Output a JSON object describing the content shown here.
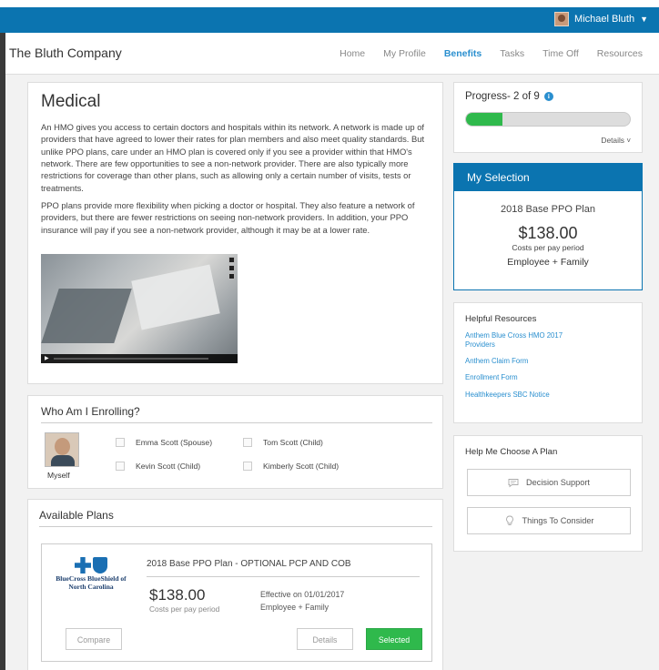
{
  "topbar": {
    "user_name": "Michael Bluth"
  },
  "navbar": {
    "brand": "The Bluth Company",
    "links": [
      "Home",
      "My Profile",
      "Benefits",
      "Tasks",
      "Time Off",
      "Resources"
    ],
    "active": "Benefits"
  },
  "medical": {
    "title": "Medical",
    "paragraph1": "An HMO gives you access to certain doctors and hospitals within its network. A network is made up of providers that have agreed to lower their rates for plan members and also meet quality standards. But unlike PPO plans, care under an HMO plan is covered only if you see a provider within that HMO's network. There are few opportunities to see a non-network provider. There are also typically more restrictions for coverage than other plans, such as allowing only a certain number of visits, tests or treatments.",
    "paragraph2": "PPO plans provide more flexibility when picking a doctor or hospital. They also feature a network of providers, but there are fewer restrictions on seeing non-network providers. In addition, your PPO insurance will pay if you see a non-network provider, although it may be at a lower rate."
  },
  "enrolling": {
    "title": "Who Am I Enrolling?",
    "self_label": "Myself",
    "dependents": [
      "Emma Scott (Spouse)",
      "Tom Scott (Child)",
      "Kevin Scott (Child)",
      "Kimberly Scott (Child)"
    ]
  },
  "plans": {
    "title": "Available Plans",
    "carrier": "BlueCross BlueShield of North Carolina",
    "plan_name": "2018 Base PPO Plan - OPTIONAL PCP AND COB",
    "price": "$138.00",
    "cost_label": "Costs per pay period",
    "effective": "Effective on 01/01/2017",
    "coverage": "Employee + Family",
    "compare_label": "Compare",
    "details_label": "Details",
    "selected_label": "Selected"
  },
  "progress": {
    "label": "Progress- 2 of 9",
    "current": 2,
    "total": 9,
    "details_label": "Details"
  },
  "selection": {
    "title": "My Selection",
    "plan": "2018 Base PPO Plan",
    "price": "$138.00",
    "cost_label": "Costs per pay period",
    "coverage": "Employee + Family"
  },
  "resources": {
    "title": "Helpful Resources",
    "links": [
      "Anthem Blue Cross HMO 2017 Providers",
      "Anthem Claim Form",
      "Enrollment Form",
      "Healthkeepers SBC Notice"
    ]
  },
  "help": {
    "title": "Help Me Choose A Plan",
    "decision_label": "Decision Support",
    "consider_label": "Things To Consider"
  },
  "colors": {
    "primary": "#0b74b0",
    "accent_link": "#2a8fcf",
    "success": "#2fb94c"
  },
  "icons": {
    "user_avatar": "avatar",
    "info": "info-icon",
    "chevron": "chevron-down-icon",
    "chat": "chat-bubble-icon",
    "bulb": "lightbulb-icon",
    "play": "play-icon"
  }
}
